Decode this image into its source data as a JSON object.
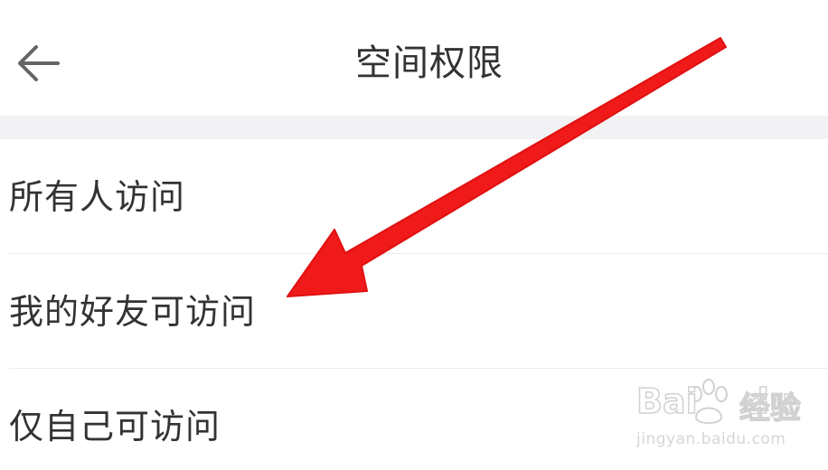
{
  "header": {
    "title": "空间权限",
    "back_icon": "arrow-left-icon"
  },
  "options": [
    {
      "label": "所有人访问"
    },
    {
      "label": "我的好友可访问"
    },
    {
      "label": "仅自己可访问"
    }
  ],
  "annotation": {
    "arrow_icon": "red-arrow-icon",
    "arrow_color": "#f01a1a"
  },
  "watermark": {
    "logo": "Bai du 经验",
    "url": "jingyan.baidu.com"
  },
  "colors": {
    "text": "#333333",
    "band": "#f2f2f4",
    "accent_red": "#f01a1a"
  }
}
